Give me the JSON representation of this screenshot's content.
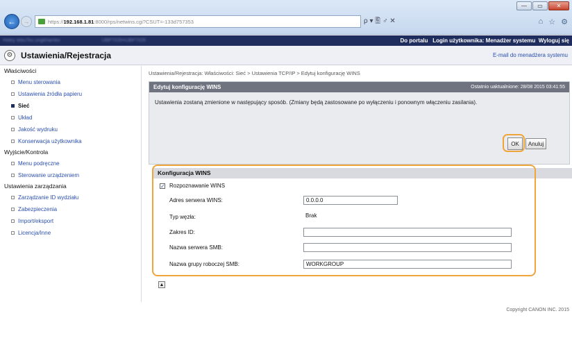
{
  "browser": {
    "window_controls": [
      "—",
      "▭",
      "✕"
    ],
    "address_prefix": "https://",
    "address_host": "192.168.1.81",
    "address_rest": ":8000/rps/netwins.cgi?CSUT=-133d757353",
    "address_controls": "ρ ▾ 🖺 ♂ ✕",
    "icons": [
      "home-icon",
      "star-icon",
      "gear-icon"
    ]
  },
  "appbar": {
    "left_blur_1": "Hidey lebu7ku ungkhamko",
    "left_blur_2": "UBP7IO5•\\UBP7IO5",
    "links": [
      "Do portalu",
      "Login użytkownika: Menadżer systemu",
      "Wyloguj się"
    ]
  },
  "header": {
    "title": "Ustawienia/Rejestracja",
    "mail_link": "E-mail do menadżera systemu"
  },
  "sidebar": {
    "group1": "Właściwości",
    "group1_items": [
      "Menu sterowania",
      "Ustawienia źródła papieru",
      "Sieć",
      "Układ",
      "Jakość wydruku",
      "Konserwacja użytkownika"
    ],
    "group2": "Wyjście/Kontrola",
    "group2_items": [
      "Menu podręczne",
      "Sterowanie urządzeniem"
    ],
    "group3": "Ustawienia zarządzania",
    "group3_items": [
      "Zarządzanie ID wydziału",
      "Zabezpieczenia",
      "Import/eksport",
      "Licencja/Inne"
    ]
  },
  "breadcrumb": "Ustawienia/Rejestracja: Właściwości: Sieć > Ustawienia TCP/IP > Edytuj konfigurację WINS",
  "panel": {
    "title": "Edytuj konfigurację WINS",
    "updated": "Ostatnio uaktualnione: 28/08 2015 03:41:55",
    "message": "Ustawienia zostaną zmienione w następujący sposób. (Zmiany będą zastosowane po wyłączeniu i ponownym włączeniu zasilania).",
    "ok_label": "OK",
    "cancel_label": "Anuluj"
  },
  "wins": {
    "section_title": "Konfiguracja WINS",
    "resolution_label": "Rozpoznawanie WINS",
    "resolution_checked": true,
    "server_label": "Adres serwera WINS:",
    "server_value": "0.0.0.0",
    "node_type_label": "Typ węzła:",
    "node_type_value": "Brak",
    "scope_label": "Zakres ID:",
    "scope_value": "",
    "smb_server_label": "Nazwa serwera SMB:",
    "smb_server_value": "",
    "smb_group_label": "Nazwa grupy roboczej SMB:",
    "smb_group_value": "WORKGROUP"
  },
  "footer": {
    "copyright": "Copyright CANON INC. 2015"
  }
}
